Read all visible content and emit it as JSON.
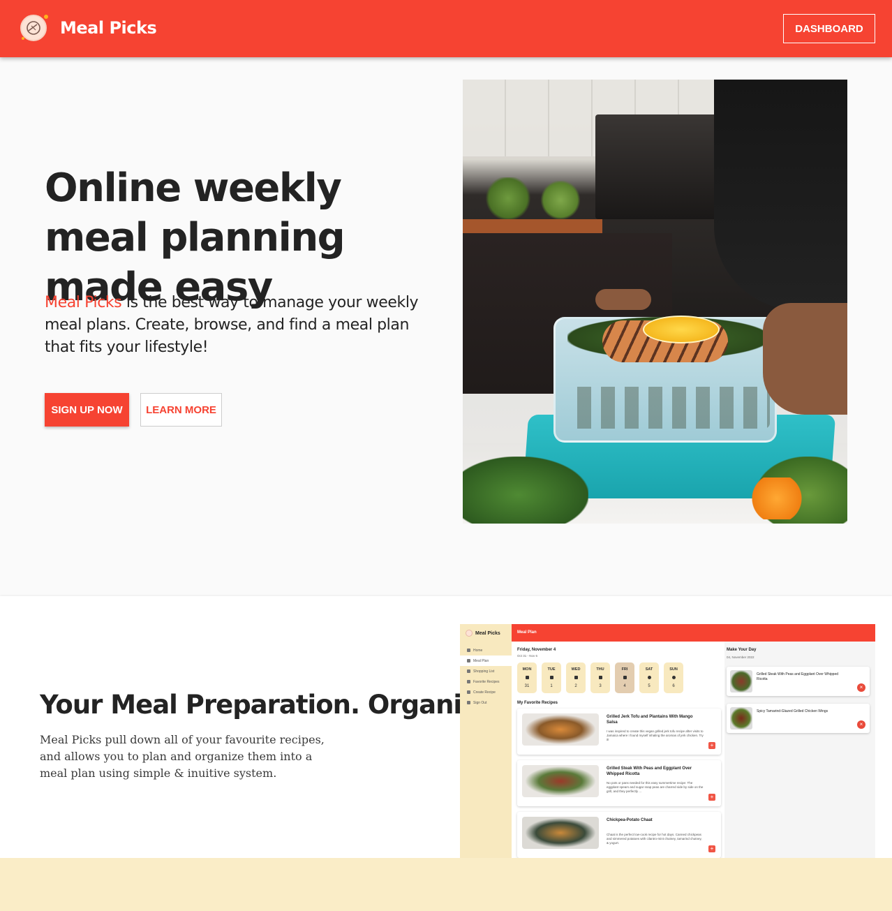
{
  "header": {
    "brand": "Meal Picks",
    "dashboard_label": "DASHBOARD",
    "brand_color": "#f64332"
  },
  "hero": {
    "title": "Online weekly meal planning made easy",
    "text_accent": "Meal Picks",
    "text_rest": " is the best way to manage your weekly meal plans. Create, browse, and find a meal plan that fits your lifestyle!",
    "signup_label": "SIGN UP NOW",
    "learn_label": "LEARN MORE",
    "photo_icon": "meal-prep-container-photo"
  },
  "section2": {
    "title": "Your Meal Preparation. Organized.",
    "text": "Meal Picks pull down all of your favourite recipes, and allows you to plan and organize them into a meal plan using simple & inuitive system."
  },
  "app_preview": {
    "brand": "Meal Picks",
    "header": "Meal Plan",
    "nav": [
      "Home",
      "Meal Plan",
      "Shopping List",
      "Favorite Recipes",
      "Create Recipe",
      "Sign Out"
    ],
    "date": "Friday, November 4",
    "range": "Oct 31 - Nov 6",
    "days": [
      {
        "name": "MON",
        "num": "31"
      },
      {
        "name": "TUE",
        "num": "1"
      },
      {
        "name": "WED",
        "num": "2"
      },
      {
        "name": "THU",
        "num": "3"
      },
      {
        "name": "FRI",
        "num": "4"
      },
      {
        "name": "SAT",
        "num": "5"
      },
      {
        "name": "SUN",
        "num": "6"
      }
    ],
    "favorites_heading": "My Favorite Recipes",
    "favorites": [
      {
        "title": "Grilled Jerk Tofu and Plantains With Mango Salsa",
        "desc": "I was inspired to create this vegan grilled jerk tofu recipe after visits to Jamaica where I found myself inhaling the aromas of jerk chicken. Try it!"
      },
      {
        "title": "Grilled Steak With Peas and Eggplant Over Whipped Ricotta",
        "desc": "No pots or pans needed for this easy summertime recipe: The eggplant spears and sugar snap peas are charred side by side on the grill, and they perfectly ..."
      },
      {
        "title": "Chickpea-Potato Chaat",
        "desc": "Chaat is the perfect low-cook recipe for hot days. Canned chickpeas and simmered potatoes with cilantro-mint chutney, tamarind chutney, & yogurt."
      }
    ],
    "make_heading": "Make Your Day",
    "make_date": "04, November 2022",
    "make_items": [
      "Grilled Steak With Peas and Eggplant Over Whipped Ricotta",
      "Spicy Tamarind-Glazed Grilled Chicken Wings"
    ]
  }
}
